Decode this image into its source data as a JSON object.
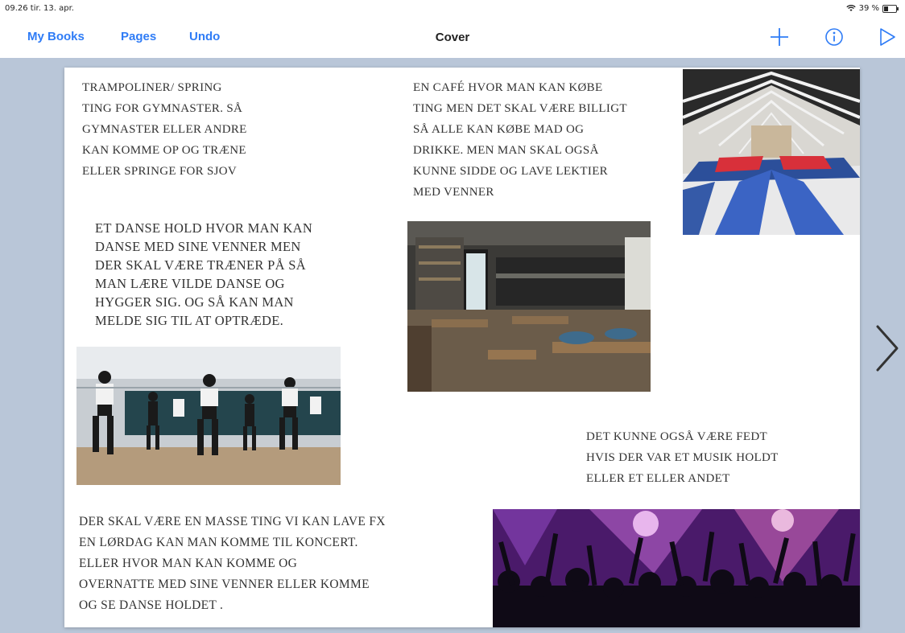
{
  "status_bar": {
    "time_date": "09.26  tir. 13. apr.",
    "battery": "39 %",
    "battery_level": 0.39
  },
  "nav": {
    "my_books": "My Books",
    "pages": "Pages",
    "undo": "Undo",
    "title": "Cover",
    "accent_color": "#2f7cf6",
    "icons": [
      "add-icon",
      "info-icon",
      "play-icon"
    ]
  },
  "page": {
    "text_trampoline": "TRAMPOLINER/ SPRING\nTING FOR GYMNASTER. SÅ\nGYMNASTER ELLER ANDRE\nKAN KOMME OP OG TRÆNE\nELLER SPRINGE FOR SJOV",
    "text_cafe": "EN CAFÉ HVOR MAN KAN KØBE\nTING MEN DET SKAL VÆRE BILLIGT\nSÅ ALLE KAN KØBE MAD OG\nDRIKKE. MEN MAN SKAL OGSÅ\nKUNNE SIDDE OG LAVE LEKTIER\nMED VENNER",
    "text_dance": "ET DANSE HOLD HVOR MAN KAN\nDANSE MED SINE VENNER MEN\nDER SKAL VÆRE TRÆNER PÅ SÅ\nMAN LÆRE VILDE DANSE OG\nHYGGER SIG. OG SÅ KAN MAN\nMELDE SIG TIL AT OPTRÆDE.",
    "text_music": "DET KUNNE OGSÅ VÆRE FEDT\nHVIS DER VAR ET MUSIK HOLDT\nELLER ET ELLER ANDET",
    "text_events": "DER SKAL VÆRE EN MASSE TING VI KAN LAVE FX\nEN LØRDAG KAN MAN KOMME TIL KONCERT.\nELLER HVOR MAN KAN KOMME OG\nOVERNATTE MED SINE VENNER ELLER KOMME\nOG SE DANSE HOLDET ."
  },
  "colors": {
    "canvas_background": "#b9c6d8",
    "page_background": "#ffffff"
  }
}
